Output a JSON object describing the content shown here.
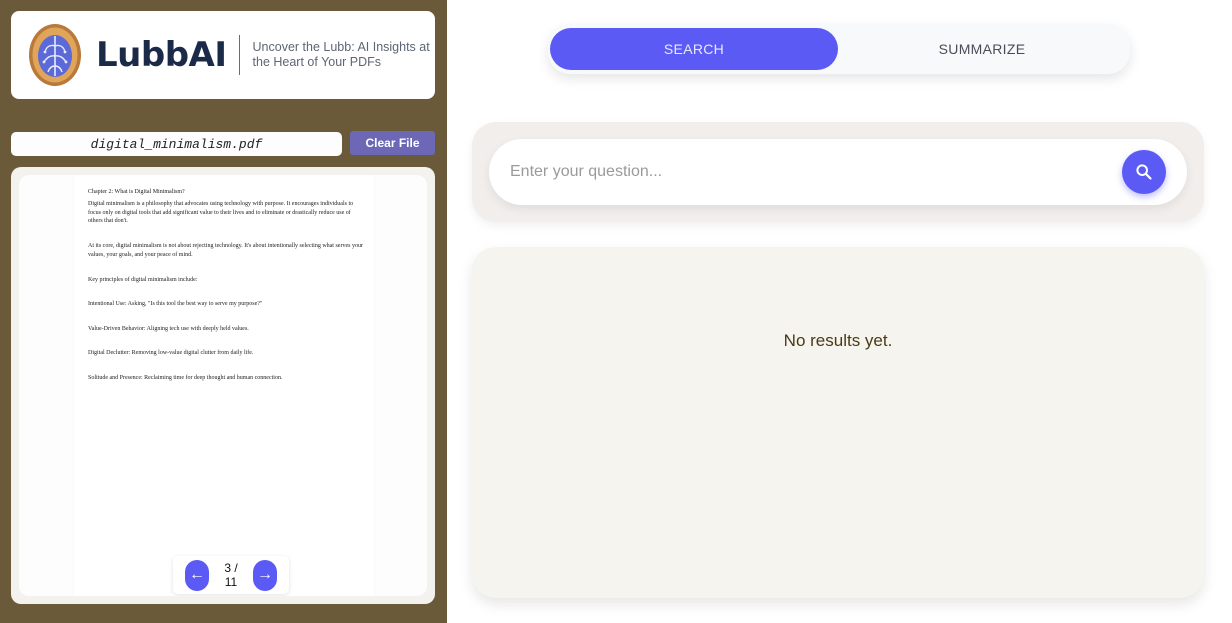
{
  "brand": {
    "name": "LubbAI",
    "tagline": "Uncover the Lubb: AI Insights at the Heart of Your PDFs"
  },
  "file": {
    "name": "digital_minimalism.pdf",
    "clear_label": "Clear File"
  },
  "pdf": {
    "lines": [
      "Chapter 2: What is Digital Minimalism?",
      "Digital minimalism is a philosophy that advocates using technology with purpose. It encourages individuals to focus only on digital tools that add significant value to their lives and to eliminate or drastically reduce use of others that don't.",
      "At its core, digital minimalism is not about rejecting technology. It's about intentionally selecting what serves your values, your goals, and your peace of mind.",
      "Key principles of digital minimalism include:",
      "Intentional Use: Asking, \"Is this tool the best way to serve my purpose?\"",
      "Value-Driven Behavior: Aligning tech use with deeply held values.",
      "Digital Declutter: Removing low-value digital clutter from daily life.",
      "Solitude and Presence: Reclaiming time for deep thought and human connection."
    ]
  },
  "pager": {
    "prev": "←",
    "next": "→",
    "count": "3 / 11"
  },
  "tabs": {
    "search": "SEARCH",
    "summarize": "SUMMARIZE",
    "active": "search"
  },
  "search": {
    "placeholder": "Enter your question..."
  },
  "results": {
    "empty_text": "No results yet."
  },
  "colors": {
    "sidebar": "#6b5a3a",
    "accent": "#5b5af5",
    "clear_button": "#6d68b5",
    "brand_text": "#1c2a4a"
  },
  "icons": {
    "logo": "walnut-brain-logo",
    "search": "search-icon",
    "prev": "arrow-left-icon",
    "next": "arrow-right-icon"
  }
}
